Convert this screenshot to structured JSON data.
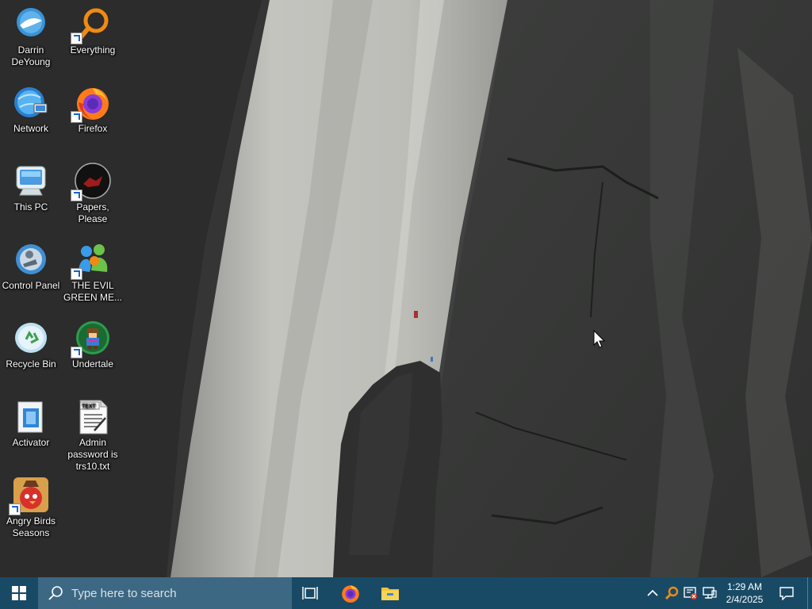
{
  "desktop": {
    "icons": [
      {
        "label": "Darrin DeYoung",
        "icon": "user-folder-icon"
      },
      {
        "label": "Everything",
        "icon": "everything-search-icon"
      },
      {
        "label": "Network",
        "icon": "network-icon"
      },
      {
        "label": "Firefox",
        "icon": "firefox-icon"
      },
      {
        "label": "This PC",
        "icon": "computer-icon"
      },
      {
        "label": "Papers, Please",
        "icon": "papers-please-icon"
      },
      {
        "label": "Control Panel",
        "icon": "control-panel-icon"
      },
      {
        "label": "THE EVIL GREEN ME...",
        "icon": "messenger-icon"
      },
      {
        "label": "Recycle Bin",
        "icon": "recycle-bin-icon"
      },
      {
        "label": "Undertale",
        "icon": "undertale-icon"
      },
      {
        "label": "Activator",
        "icon": "activator-icon"
      },
      {
        "label": "Admin password is trs10.txt",
        "icon": "text-file-icon"
      },
      {
        "label": "Angry Birds Seasons",
        "icon": "angry-birds-icon"
      }
    ]
  },
  "taskbar": {
    "search_placeholder": "Type here to search",
    "pinned": [
      {
        "name": "task-view",
        "icon": "task-view-icon"
      },
      {
        "name": "firefox",
        "icon": "firefox-icon"
      },
      {
        "name": "file-explorer",
        "icon": "folder-icon"
      }
    ],
    "tray": {
      "icons": [
        "chevron-up-icon",
        "everything-search-icon",
        "security-alert-icon",
        "network-wired-icon"
      ],
      "time": "1:29 AM",
      "date": "2/4/2025"
    }
  },
  "colors": {
    "taskbar_bg": "#184a66",
    "search_bg": "#3d6883"
  }
}
